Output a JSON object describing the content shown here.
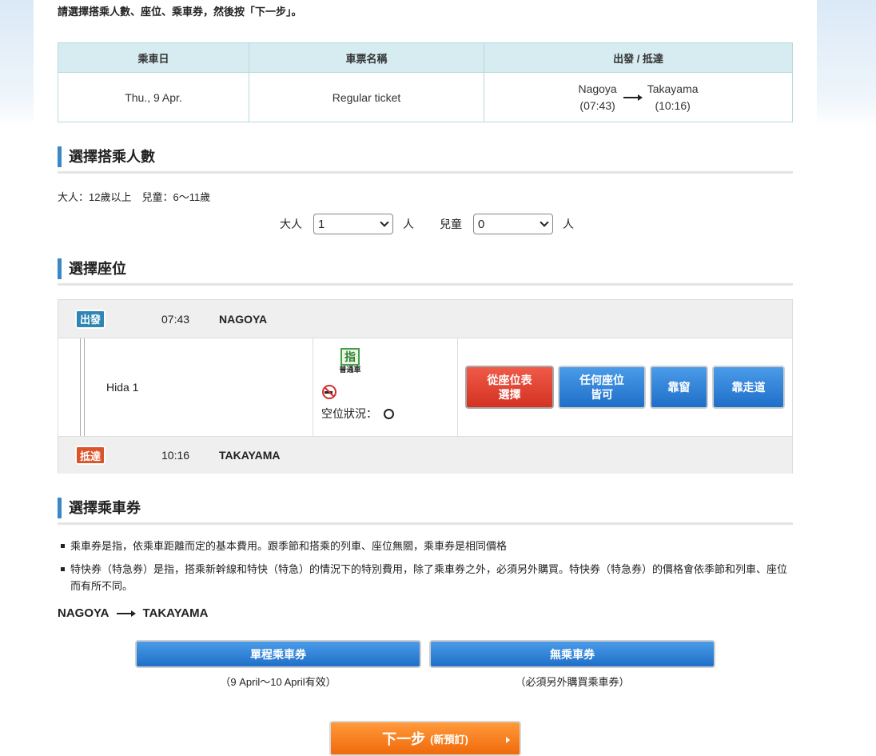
{
  "intro": "請選擇搭乘人數、座位、乘車券，然後按「下一步」。",
  "summary": {
    "headers": [
      "乘車日",
      "車票名稱",
      "出發 / 抵達"
    ],
    "date": "Thu., 9 Apr.",
    "ticket_name": "Regular ticket",
    "from_station": "Nagoya",
    "from_time": "(07:43)",
    "to_station": "Takayama",
    "to_time": "(10:16)"
  },
  "passengers": {
    "title": "選擇搭乘人數",
    "age_note": "大人：12歲以上　兒童：6～11歲",
    "adult_label": "大人",
    "adult_value": "1",
    "child_label": "兒童",
    "child_value": "0",
    "unit": "人"
  },
  "seat": {
    "title": "選擇座位",
    "departure": {
      "badge": "出發",
      "time": "07:43",
      "station": "NAGOYA"
    },
    "arrival": {
      "badge": "抵達",
      "time": "10:16",
      "station": "TAKAYAMA"
    },
    "train_name": "Hida 1",
    "car_icon_char": "指",
    "car_type": "普通車",
    "vacancy_label": "空位狀況：",
    "buttons": {
      "from_chart_line1": "從座位表",
      "from_chart_line2": "選擇",
      "any_line1": "任何座位",
      "any_line2": "皆可",
      "window": "靠窗",
      "aisle": "靠走道"
    }
  },
  "tickets": {
    "title": "選擇乘車券",
    "bullet1": "乘車券是指，依乘車距離而定的基本費用。跟季節和搭乘的列車、座位無關，乘車券是相同價格",
    "bullet2": "特快券（特急券）是指，搭乘新幹線和特快（特急）的情況下的特別費用，除了乘車券之外，必須另外購買。特快券（特急券）的價格會依季節和列車、座位而有所不同。",
    "route_from": "NAGOYA",
    "route_to": "TAKAYAMA",
    "single_label": "單程乘車券",
    "single_note": "（9 April～10 April有效）",
    "none_label": "無乘車券",
    "none_note": "（必須另外購買乘車券）"
  },
  "next": {
    "label": "下一步",
    "sub": "(新預訂)"
  },
  "colors": {
    "accent_blue": "#3a87c8",
    "button_blue": "#1f6fc9",
    "button_red": "#d33222",
    "next_orange": "#ef6a0a"
  }
}
